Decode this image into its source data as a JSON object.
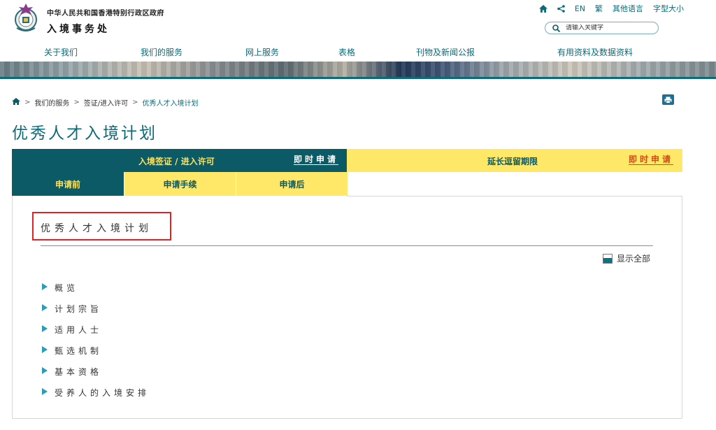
{
  "header": {
    "gov_name": "中华人民共和国香港特别行政区政府",
    "dept_name": "入境事务处",
    "utility": {
      "en": "EN",
      "traditional": "繁",
      "other_languages": "其他语言",
      "font_size": "字型大小"
    },
    "search": {
      "placeholder": "请输入关键字"
    }
  },
  "nav": [
    {
      "label": "关于我们"
    },
    {
      "label": "我们的服务"
    },
    {
      "label": "网上服务"
    },
    {
      "label": "表格"
    },
    {
      "label": "刊物及新闻公报"
    },
    {
      "label": "有用资料及数据资料"
    }
  ],
  "breadcrumb": [
    {
      "label": "我们的服务"
    },
    {
      "label": "签证/进入许可"
    },
    {
      "label": "优秀人才入境计划"
    }
  ],
  "page_title": "优秀人才入境计划",
  "tabs": {
    "main": [
      {
        "label": "入境签证 / 进入许可",
        "apply": "即时申请"
      },
      {
        "label": "延长逗留期限",
        "apply": "即时申请"
      }
    ],
    "sub": [
      {
        "label": "申请前"
      },
      {
        "label": "申请手续"
      },
      {
        "label": "申请后"
      }
    ]
  },
  "content": {
    "section_title": "优秀人才入境计划",
    "show_all": "显示全部",
    "accordion": [
      {
        "label": "概览"
      },
      {
        "label": "计划宗旨"
      },
      {
        "label": "适用人士"
      },
      {
        "label": "甄选机制"
      },
      {
        "label": "基本资格"
      },
      {
        "label": "受养人的入境安排"
      }
    ]
  },
  "colors": {
    "brand_teal": "#0b6b78",
    "tab_dark": "#0b5a66",
    "tab_yellow": "#ffe867",
    "apply_orange": "#d24b15",
    "highlight_red": "#e22222"
  }
}
